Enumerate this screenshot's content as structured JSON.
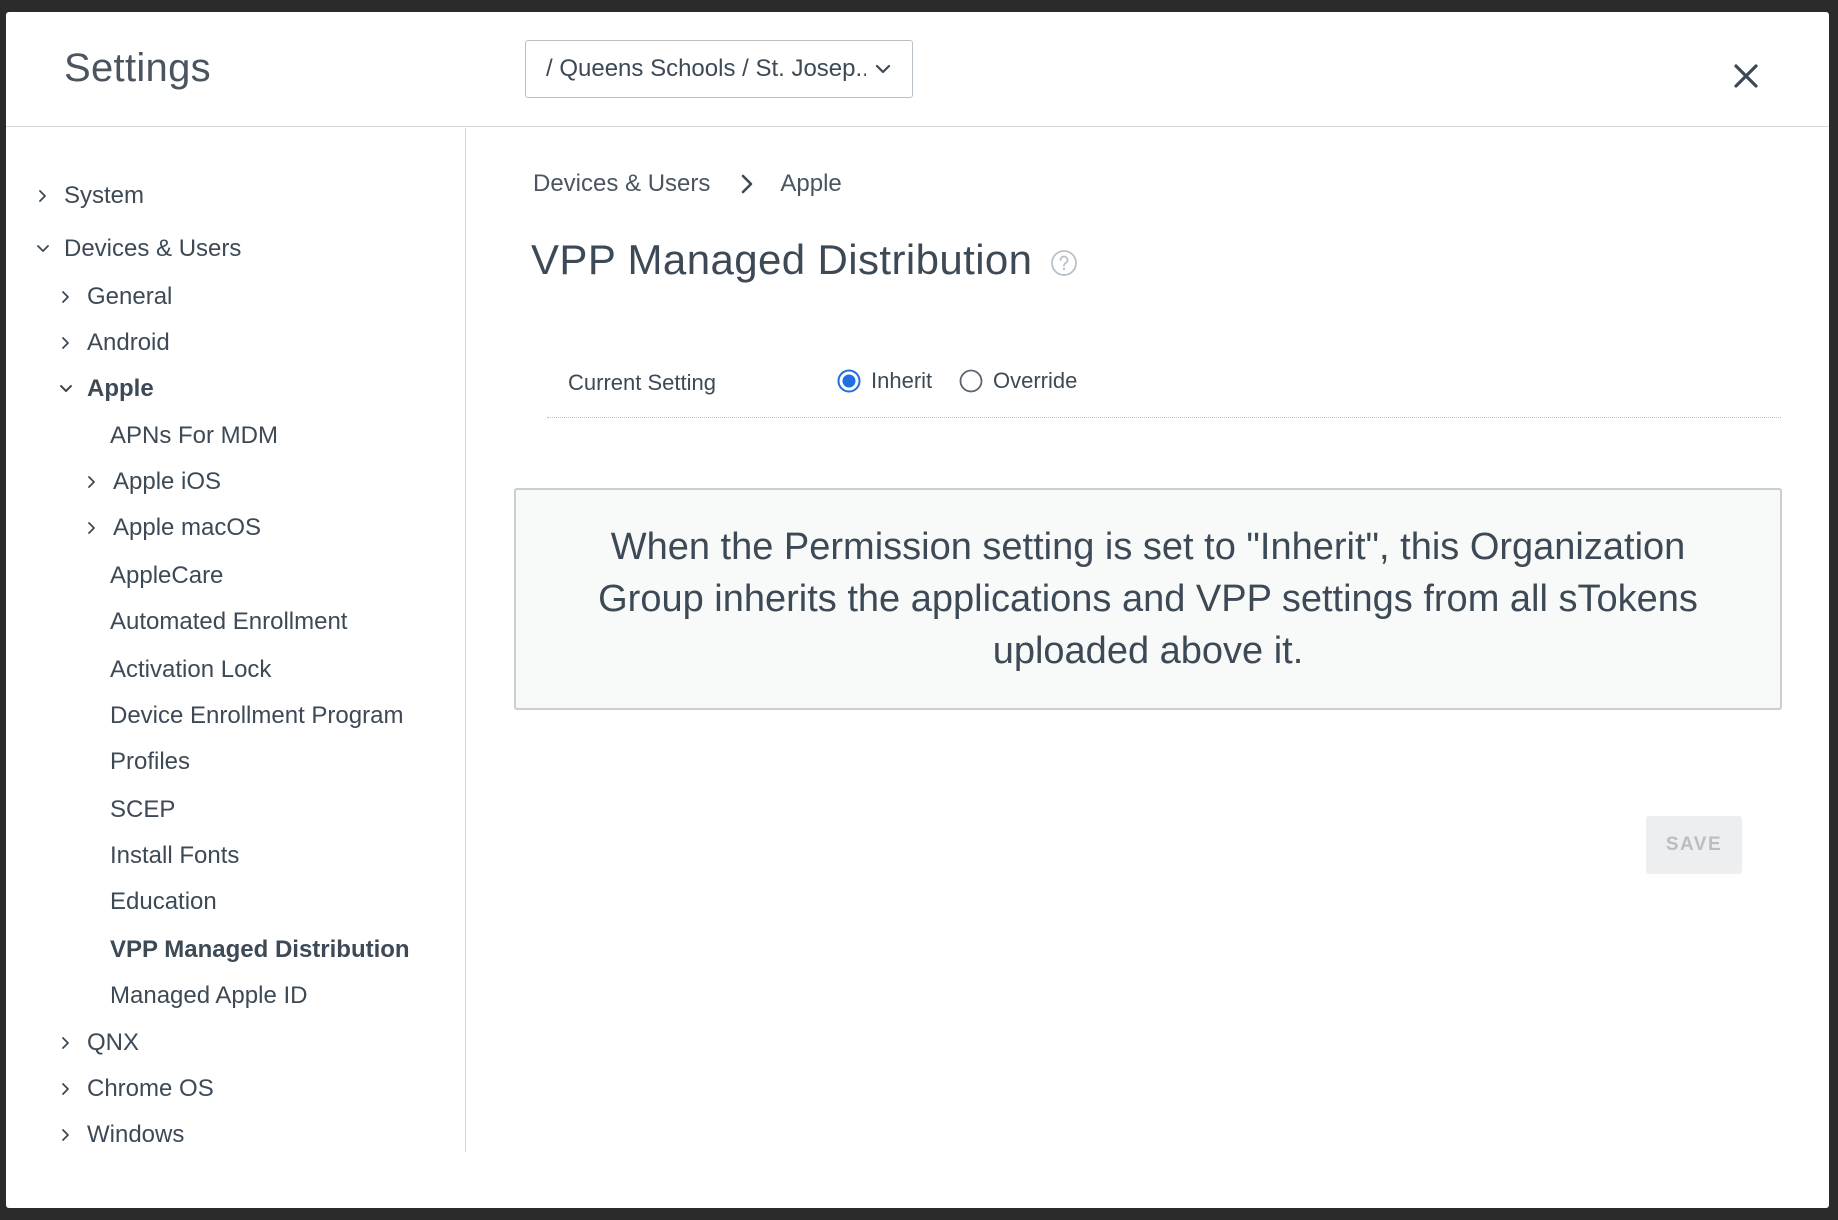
{
  "header": {
    "title": "Settings",
    "org_group_select": "/ Queens Schools / St. Josep...",
    "close_icon": "close-icon"
  },
  "sidebar": {
    "items": [
      {
        "label": "System",
        "expanded": false
      },
      {
        "label": "Devices & Users",
        "expanded": true
      },
      {
        "label": "General",
        "expanded": false
      },
      {
        "label": "Android",
        "expanded": false
      },
      {
        "label": "Apple",
        "expanded": true
      },
      {
        "label": "APNs For MDM"
      },
      {
        "label": "Apple iOS",
        "expanded": false
      },
      {
        "label": "Apple macOS",
        "expanded": false
      },
      {
        "label": "AppleCare"
      },
      {
        "label": "Automated Enrollment"
      },
      {
        "label": "Activation Lock"
      },
      {
        "label": "Device Enrollment Program"
      },
      {
        "label": "Profiles"
      },
      {
        "label": "SCEP"
      },
      {
        "label": "Install Fonts"
      },
      {
        "label": "Education"
      },
      {
        "label": "VPP Managed Distribution",
        "selected": true
      },
      {
        "label": "Managed Apple ID"
      },
      {
        "label": "QNX",
        "expanded": false
      },
      {
        "label": "Chrome OS",
        "expanded": false
      },
      {
        "label": "Windows",
        "expanded": false
      }
    ]
  },
  "breadcrumb": {
    "items": [
      "Devices & Users",
      "Apple"
    ]
  },
  "page": {
    "title": "VPP Managed Distribution",
    "help_icon": "help-circle-icon",
    "current_setting_label": "Current Setting",
    "radio_options": [
      {
        "label": "Inherit",
        "selected": true
      },
      {
        "label": "Override",
        "selected": false
      }
    ],
    "info_text": "When the Permission setting is set to \"Inherit\", this Organization Group inherits the applications and VPP settings from all sTokens uploaded above it.",
    "save_label": "SAVE"
  },
  "colors": {
    "accent": "#1f6fe0",
    "text": "#3d4a56",
    "border": "#d4d9dd",
    "info_bg": "#f8f9f9",
    "disabled_button_bg": "#eceeef",
    "disabled_button_text": "#b8bec3"
  }
}
